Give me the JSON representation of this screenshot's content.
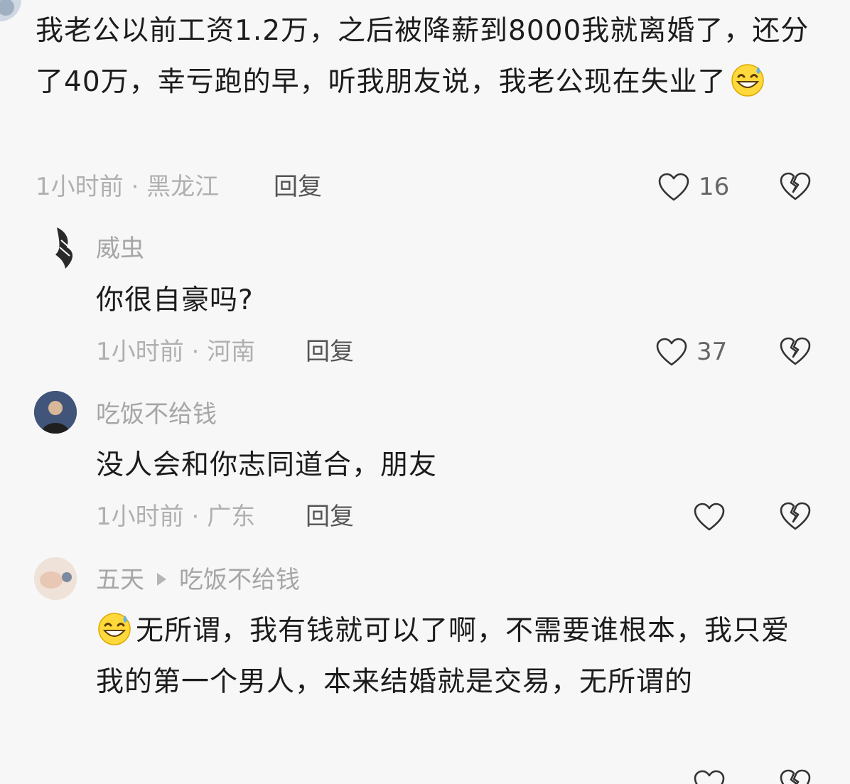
{
  "comments": [
    {
      "text_part1": "我老公以前工资1.2万，之后被降薪到8000我就离婚了，还分了40万，幸亏跑的早，听我朋友说，我老公现在失业了",
      "emoji": "grinning-sweat-emoji",
      "time": "1小时前",
      "location": "黑龙江",
      "reply_label": "回复",
      "likes": "16"
    },
    {
      "username": "威虫",
      "text": "你很自豪吗?",
      "time": "1小时前",
      "location": "河南",
      "reply_label": "回复",
      "likes": "37"
    },
    {
      "username": "吃饭不给钱",
      "text": "没人会和你志同道合，朋友",
      "time": "1小时前",
      "location": "广东",
      "reply_label": "回复",
      "likes": ""
    },
    {
      "username": "五天",
      "reply_to": "吃饭不给钱",
      "emoji": "grinning-sweat-emoji",
      "text": "无所谓，我有钱就可以了啊，不需要谁根本，我只爱我的第一个男人，本来结婚就是交易，无所谓的"
    }
  ],
  "colors": {
    "background": "#f7f7f7",
    "text": "#1c1c1c",
    "muted": "#b0b0b0"
  }
}
